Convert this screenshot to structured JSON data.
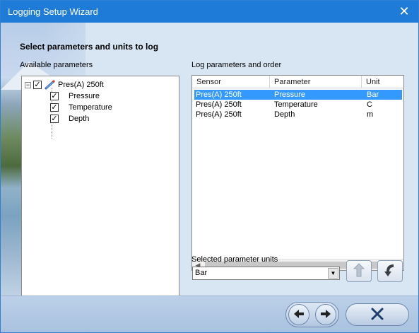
{
  "window": {
    "title": "Logging Setup Wizard",
    "close_glyph": "✕"
  },
  "page": {
    "heading": "Select parameters and units to log",
    "available_label": "Available parameters",
    "log_label": "Log parameters and order",
    "units_label": "Selected parameter units"
  },
  "tree": {
    "root": {
      "label": "Pres(A) 250ft",
      "checked": true,
      "expander": "−",
      "icon": "sensor-icon"
    },
    "children": [
      {
        "label": "Pressure",
        "checked": true
      },
      {
        "label": "Temperature",
        "checked": true
      },
      {
        "label": "Depth",
        "checked": true
      }
    ]
  },
  "log_list": {
    "columns": [
      "Sensor",
      "Parameter",
      "Unit"
    ],
    "rows": [
      {
        "sensor": "Pres(A) 250ft",
        "parameter": "Pressure",
        "unit": "Bar",
        "selected": true
      },
      {
        "sensor": "Pres(A) 250ft",
        "parameter": "Temperature",
        "unit": "C",
        "selected": false
      },
      {
        "sensor": "Pres(A) 250ft",
        "parameter": "Depth",
        "unit": "m",
        "selected": false
      }
    ]
  },
  "units": {
    "selected_value": "Bar"
  },
  "buttons": {
    "move_up_icon": "up-arrow-icon",
    "move_down_icon": "down-arrow-icon",
    "back_icon": "back-arrow-icon",
    "next_icon": "next-arrow-icon",
    "cancel_icon": "cancel-x-icon"
  },
  "colors": {
    "titlebar": "#1e7bd7",
    "selection": "#3399ff"
  }
}
